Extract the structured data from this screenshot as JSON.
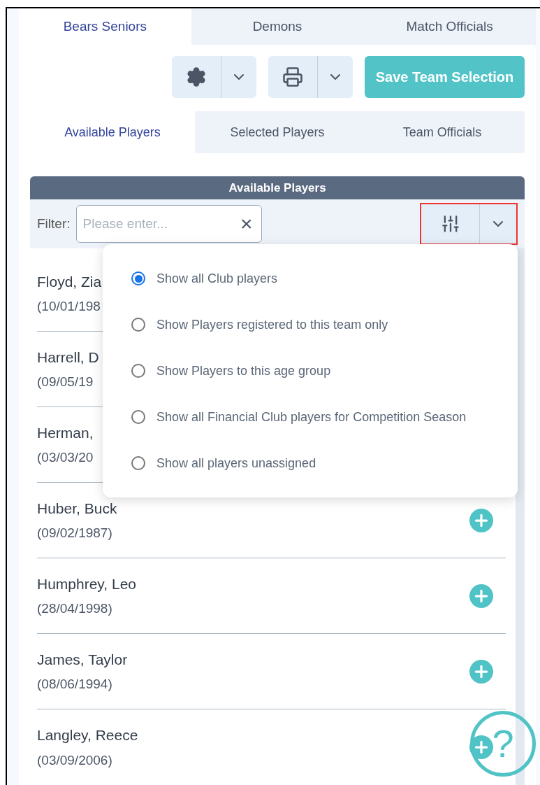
{
  "team_tabs": [
    {
      "label": "Bears Seniors",
      "selected": true
    },
    {
      "label": "Demons",
      "selected": false
    },
    {
      "label": "Match Officials",
      "selected": false
    }
  ],
  "toolbar": {
    "save_button": "Save Team Selection"
  },
  "sub_tabs": [
    {
      "label": "Available Players",
      "selected": true
    },
    {
      "label": "Selected Players",
      "selected": false
    },
    {
      "label": "Team Officials",
      "selected": false
    }
  ],
  "panel": {
    "title": "Available Players",
    "filter_label": "Filter:",
    "filter_placeholder": "Please enter...",
    "clear_icon": "×"
  },
  "filter_menu": {
    "options": [
      {
        "label": "Show all Club players",
        "selected": true
      },
      {
        "label": "Show Players registered to this team only",
        "selected": false
      },
      {
        "label": "Show Players to this age group",
        "selected": false
      },
      {
        "label": "Show all Financial Club players for Competition Season",
        "selected": false
      },
      {
        "label": "Show all players unassigned",
        "selected": false
      }
    ]
  },
  "players": [
    {
      "name": "Floyd, Zia",
      "dob": "(10/01/198"
    },
    {
      "name": "Harrell, D",
      "dob": "(09/05/19"
    },
    {
      "name": "Herman,",
      "dob": "(03/03/20"
    },
    {
      "name": "Huber, Buck",
      "dob": "(09/02/1987)"
    },
    {
      "name": "Humphrey, Leo",
      "dob": "(28/04/1998)"
    },
    {
      "name": "James, Taylor",
      "dob": "(08/06/1994)"
    },
    {
      "name": "Langley, Reece",
      "dob": "(03/09/2006)"
    }
  ],
  "help_button": "?"
}
